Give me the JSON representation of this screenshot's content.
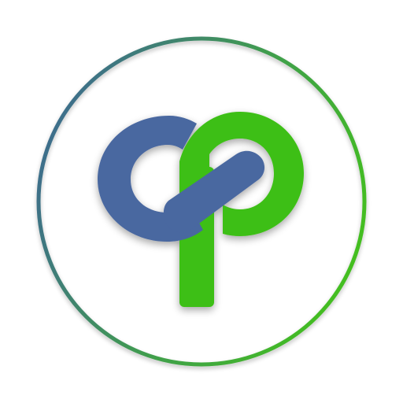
{
  "logo": {
    "letters": "cp",
    "shape": "infinity-loop-cp-monogram",
    "colors": {
      "blue": "#4a67a0",
      "blue_dark": "#3f5b92",
      "green": "#3dbf14",
      "green_dark": "#35ad10",
      "ring_start": "#3e6b8f",
      "ring_end": "#44c11c",
      "background": "#ffffff"
    }
  }
}
